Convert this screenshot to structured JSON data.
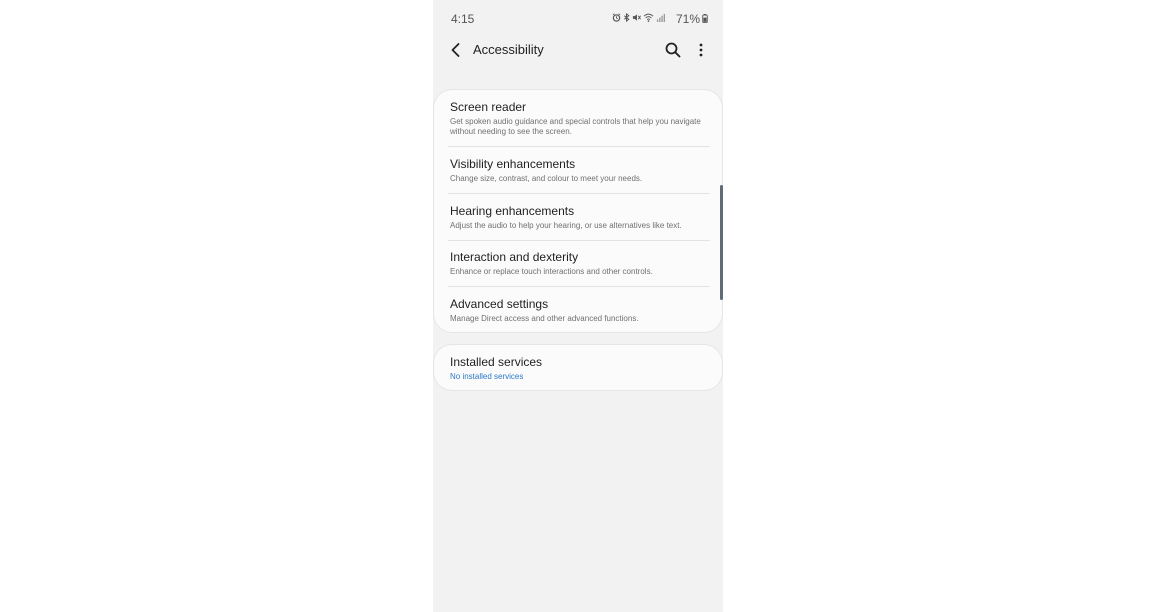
{
  "status_bar": {
    "time": "4:15",
    "battery": "71%",
    "icons": [
      "alarm-icon",
      "bluetooth-icon",
      "mute-icon",
      "wifi-icon",
      "signal-icon",
      "battery-icon"
    ]
  },
  "app_bar": {
    "title": "Accessibility",
    "back_icon": "back-arrow-icon",
    "search_icon": "search-icon",
    "more_icon": "more-vert-icon"
  },
  "settings": [
    {
      "title": "Screen reader",
      "subtitle": "Get spoken audio guidance and special controls that help you navigate without needing to see the screen."
    },
    {
      "title": "Visibility enhancements",
      "subtitle": "Change size, contrast, and colour to meet your needs."
    },
    {
      "title": "Hearing enhancements",
      "subtitle": "Adjust the audio to help your hearing, or use alternatives like text."
    },
    {
      "title": "Interaction and dexterity",
      "subtitle": "Enhance or replace touch interactions and other controls."
    },
    {
      "title": "Advanced settings",
      "subtitle": "Manage Direct access and other advanced functions."
    }
  ],
  "installed_services": {
    "title": "Installed services",
    "subtitle": "No installed services"
  },
  "colors": {
    "background": "#f2f2f2",
    "card": "#fbfbfb",
    "accent": "#2a78c8"
  }
}
